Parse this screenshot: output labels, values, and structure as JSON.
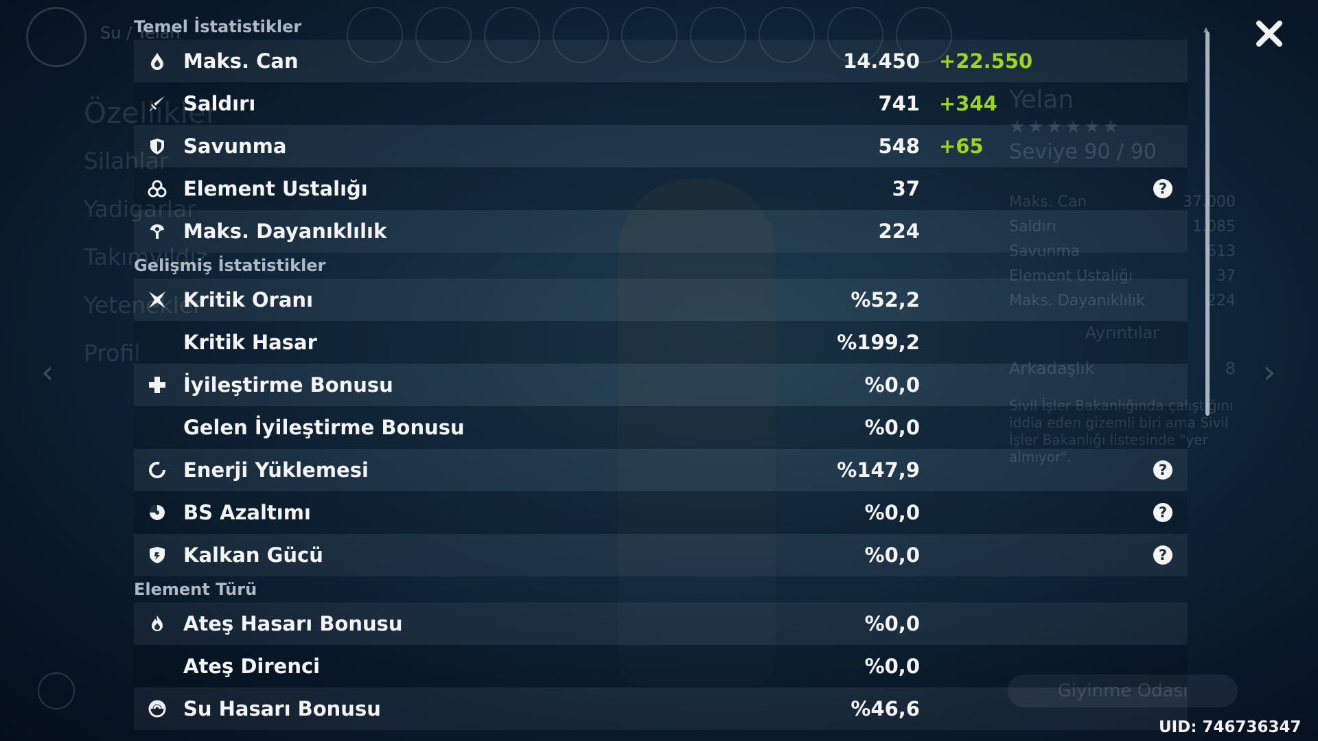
{
  "background": {
    "breadcrumb": "Su / Yelan",
    "nav": [
      "Özellikler",
      "Silahlar",
      "Yadigarlar",
      "Takımyıldız",
      "Yetenekler",
      "Profil"
    ],
    "character": {
      "name": "Yelan",
      "stars": "★★★★★★",
      "level": "Seviye 90 / 90",
      "stats": [
        {
          "label": "Maks. Can",
          "value": "37.000"
        },
        {
          "label": "Saldırı",
          "value": "1.085"
        },
        {
          "label": "Savunma",
          "value": "613"
        },
        {
          "label": "Element Ustalığı",
          "value": "37"
        },
        {
          "label": "Maks. Dayanıklılık",
          "value": "224"
        }
      ],
      "details_label": "Ayrıntılar",
      "friendship_label": "Arkadaşlık",
      "friendship_value": "8",
      "description": "Sivil İşler Bakanlığında çalıştığını iddia eden gizemli biri ama Sivil İşler Bakanlığı listesinde \"yer almıyor\"."
    },
    "wardrobe_label": "Giyinme Odası"
  },
  "sections": [
    {
      "title": "Temel İstatistikler",
      "rows": [
        {
          "icon": "hp-drop-icon",
          "label": "Maks. Can",
          "value": "14.450",
          "bonus": "+22.550",
          "help": false
        },
        {
          "icon": "sword-icon",
          "label": "Saldırı",
          "value": "741",
          "bonus": "+344",
          "help": false
        },
        {
          "icon": "shield-icon",
          "label": "Savunma",
          "value": "548",
          "bonus": "+65",
          "help": false
        },
        {
          "icon": "elemental-mastery-icon",
          "label": "Element Ustalığı",
          "value": "37",
          "bonus": "",
          "help": true
        },
        {
          "icon": "stamina-icon",
          "label": "Maks. Dayanıklılık",
          "value": "224",
          "bonus": "",
          "help": false
        }
      ]
    },
    {
      "title": "Gelişmiş İstatistikler",
      "rows": [
        {
          "icon": "crit-rate-icon",
          "label": "Kritik Oranı",
          "value": "%52,2",
          "bonus": "",
          "help": false
        },
        {
          "icon": "",
          "label": "Kritik Hasar",
          "value": "%199,2",
          "bonus": "",
          "help": false
        },
        {
          "icon": "healing-cross-icon",
          "label": "İyileştirme Bonusu",
          "value": "%0,0",
          "bonus": "",
          "help": false
        },
        {
          "icon": "",
          "label": "Gelen İyileştirme Bonusu",
          "value": "%0,0",
          "bonus": "",
          "help": false
        },
        {
          "icon": "energy-recharge-icon",
          "label": "Enerji Yüklemesi",
          "value": "%147,9",
          "bonus": "",
          "help": true
        },
        {
          "icon": "cooldown-icon",
          "label": "BS Azaltımı",
          "value": "%0,0",
          "bonus": "",
          "help": true
        },
        {
          "icon": "shield-strength-icon",
          "label": "Kalkan Gücü",
          "value": "%0,0",
          "bonus": "",
          "help": true
        }
      ]
    },
    {
      "title": "Element Türü",
      "rows": [
        {
          "icon": "pyro-icon",
          "label": "Ateş Hasarı Bonusu",
          "value": "%0,0",
          "bonus": "",
          "help": false
        },
        {
          "icon": "",
          "label": "Ateş Direnci",
          "value": "%0,0",
          "bonus": "",
          "help": false
        },
        {
          "icon": "hydro-icon",
          "label": "Su Hasarı Bonusu",
          "value": "%46,6",
          "bonus": "",
          "help": false
        }
      ]
    }
  ],
  "help_symbol": "?",
  "uid": "UID: 746736347"
}
